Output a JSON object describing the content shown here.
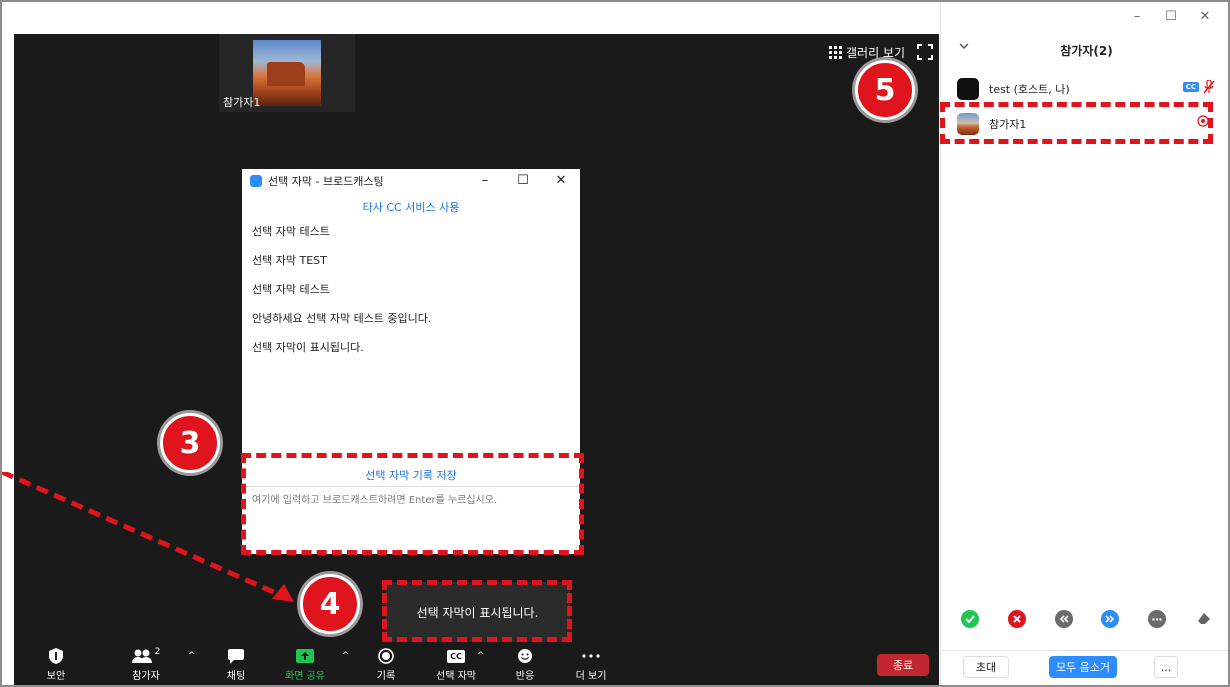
{
  "meeting": {
    "thumbnail_name": "참가자1",
    "gallery_view_label": "갤러리 보기",
    "caption_toast": "선택 자막이 표시됩니다."
  },
  "cc_window": {
    "title": "선택 자막 - 브로드캐스팅",
    "controls": {
      "minimize": "–",
      "maximize": "☐",
      "close": "✕"
    },
    "third_party_link": "타사 CC 서비스 사용",
    "lines": [
      "선택 자막 테스트",
      "선택 자막 TEST",
      "선택 자막 테스트",
      "안녕하세요 선택 자막 테스트 중입니다.",
      "선택 자막이 표시됩니다."
    ],
    "save_link": "선택 자막 기록 저장",
    "input_placeholder": "여기에 입력하고 브로드캐스트하려면 Enter를 누르십시오."
  },
  "badges": {
    "b3": "3",
    "b4": "4",
    "b5": "5"
  },
  "toolbar": {
    "security": "보안",
    "participants": "참가자",
    "participants_count": "2",
    "chat": "채팅",
    "share": "화면 공유",
    "record": "기록",
    "cc": "선택 자막",
    "cc_icon_text": "CC",
    "reactions": "반응",
    "more": "더 보기",
    "end": "종료"
  },
  "panel": {
    "window_controls": {
      "minimize": "–",
      "maximize": "☐",
      "close": "✕"
    },
    "title": "참가자(2)",
    "participants": [
      {
        "name": "test (호스트, 나)",
        "cc_badge": "CC"
      },
      {
        "name": "참가자1"
      }
    ],
    "invite": "초대",
    "mute_all": "모두 음소거",
    "more": "..."
  },
  "colors": {
    "meeting_bg": "#1a1a1a",
    "accent_red": "#e0141c",
    "zoom_blue": "#2d8cff",
    "end_red": "#c2262e",
    "share_green": "#23c552"
  }
}
